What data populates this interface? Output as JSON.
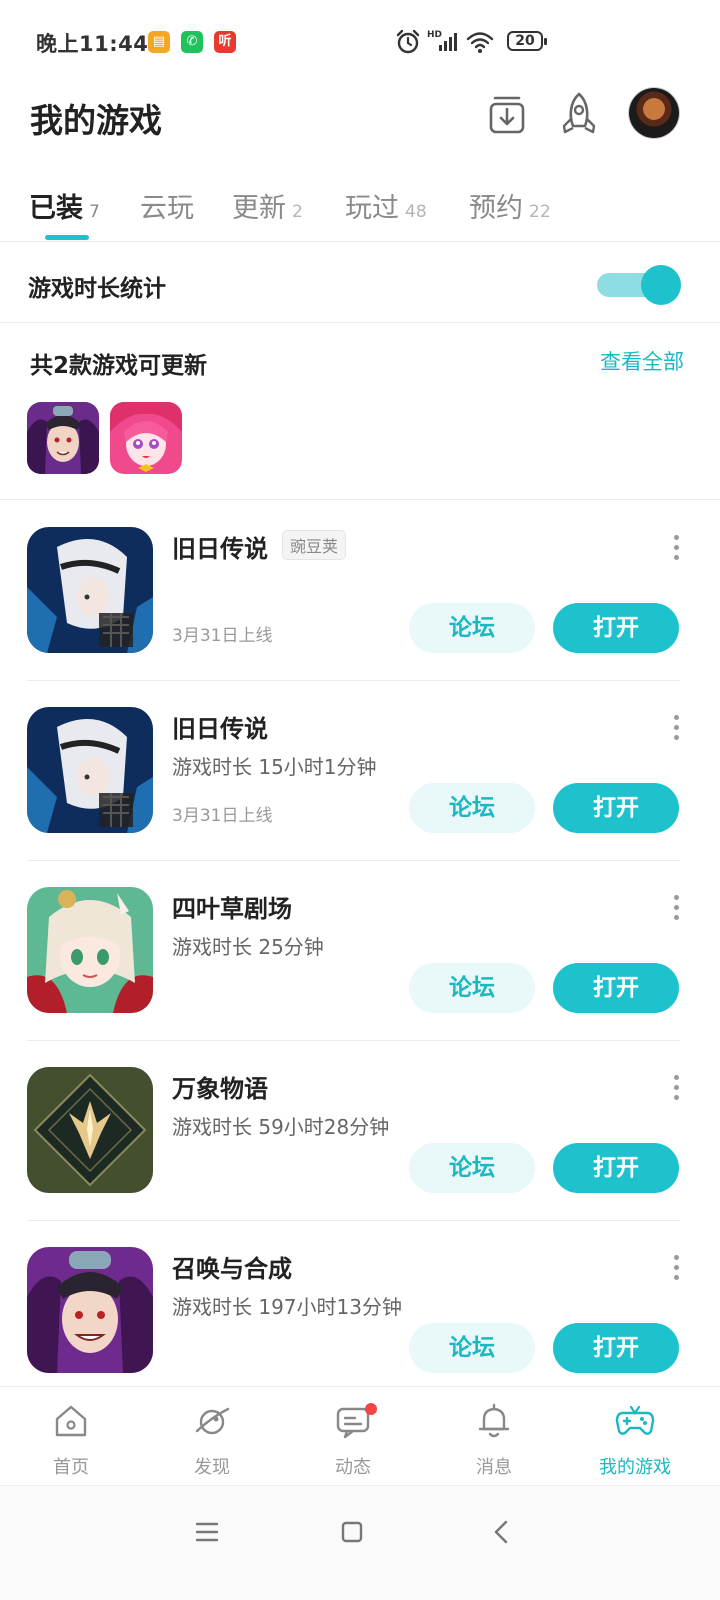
{
  "status_bar": {
    "time": "晚上11:44",
    "battery": "20",
    "notification_icons": [
      "sms-icon",
      "wechat-icon",
      "ting-icon"
    ],
    "notification_glyphs": [
      "▤",
      "✆",
      "听"
    ],
    "system_icons": [
      "alarm-icon",
      "signal-icon",
      "wifi-icon",
      "battery-icon"
    ]
  },
  "header": {
    "title": "我的游戏",
    "download_icon": "download-manager-icon",
    "rocket_icon": "rocket-icon"
  },
  "tabs": [
    {
      "label": "已装",
      "count": "7",
      "active": true
    },
    {
      "label": "云玩",
      "count": "",
      "active": false
    },
    {
      "label": "更新",
      "count": "2",
      "active": false
    },
    {
      "label": "玩过",
      "count": "48",
      "active": false
    },
    {
      "label": "预约",
      "count": "22",
      "active": false
    }
  ],
  "stats": {
    "label": "游戏时长统计",
    "toggle_on": true
  },
  "updates": {
    "title": "共2款游戏可更新",
    "view_all": "查看全部"
  },
  "games": [
    {
      "name": "旧日传说",
      "tag": "豌豆荚",
      "playtime": "",
      "launch_date": "3月31日上线",
      "forum": "论坛",
      "open": "打开"
    },
    {
      "name": "旧日传说",
      "tag": "",
      "playtime": "游戏时长 15小时1分钟",
      "launch_date": "3月31日上线",
      "forum": "论坛",
      "open": "打开"
    },
    {
      "name": "四叶草剧场",
      "tag": "",
      "playtime": "游戏时长 25分钟",
      "launch_date": "",
      "forum": "论坛",
      "open": "打开"
    },
    {
      "name": "万象物语",
      "tag": "",
      "playtime": "游戏时长 59小时28分钟",
      "launch_date": "",
      "forum": "论坛",
      "open": "打开"
    },
    {
      "name": "召唤与合成",
      "tag": "",
      "playtime": "游戏时长 197小时13分钟",
      "launch_date": "",
      "forum": "论坛",
      "open": "打开"
    }
  ],
  "bottom_nav": [
    {
      "label": "首页",
      "icon": "home-icon",
      "active": false
    },
    {
      "label": "发现",
      "icon": "planet-icon",
      "active": false
    },
    {
      "label": "动态",
      "icon": "chat-icon",
      "active": false,
      "badge": true
    },
    {
      "label": "消息",
      "icon": "bell-icon",
      "active": false
    },
    {
      "label": "我的游戏",
      "icon": "gamepad-icon",
      "active": true
    }
  ],
  "colors": {
    "accent": "#1ec2cc",
    "accent_light": "#e9f8f9",
    "badge": "#f04646"
  }
}
